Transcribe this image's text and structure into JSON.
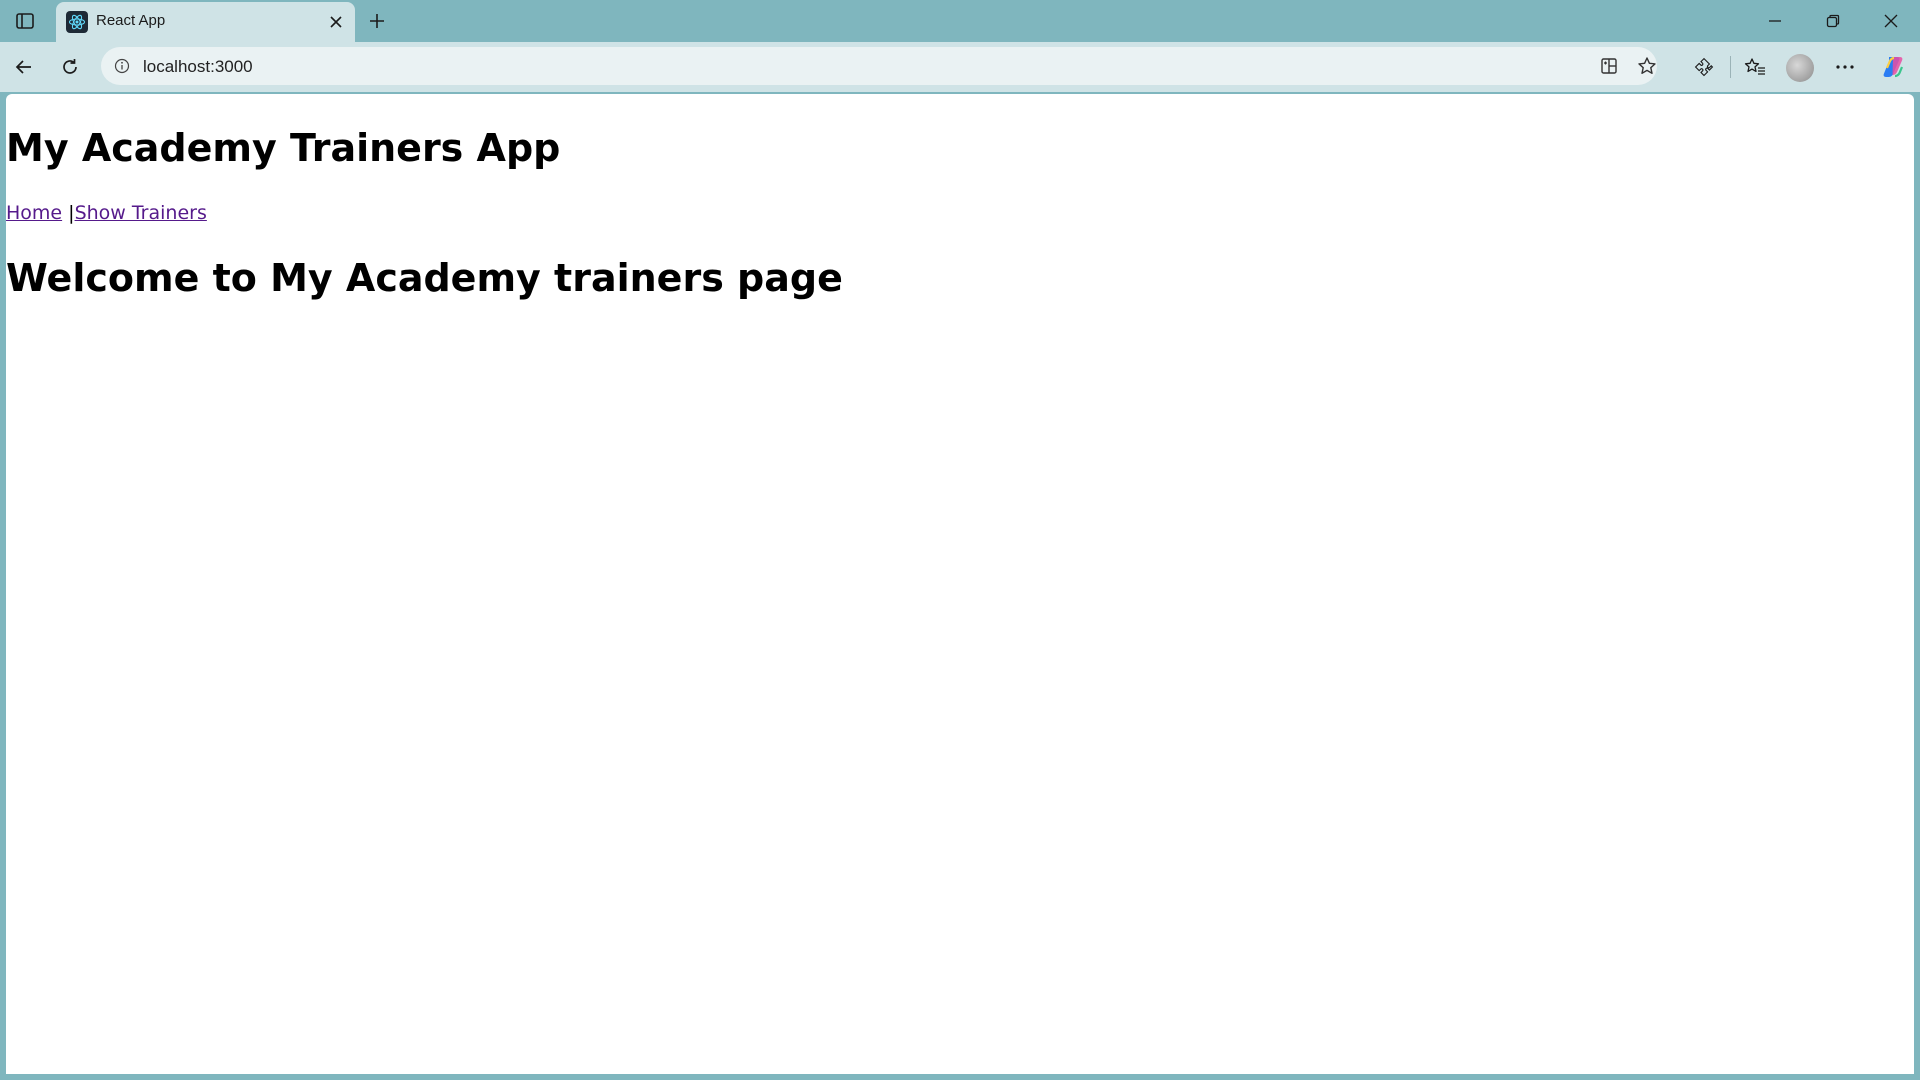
{
  "browser": {
    "tab": {
      "title": "React App",
      "favicon": "react-logo-icon"
    },
    "address": {
      "url": "localhost:3000"
    },
    "icons": {
      "sidebar": "sidebar-icon",
      "close_tab": "close-icon",
      "new_tab": "plus-icon",
      "back": "back-arrow-icon",
      "reload": "reload-icon",
      "site_info": "info-icon",
      "app_available": "app-available-icon",
      "favorite": "star-icon",
      "extensions": "puzzle-icon",
      "favorites": "favorites-icon",
      "profile": "avatar",
      "more": "more-icon",
      "copilot": "copilot-icon"
    }
  },
  "page": {
    "title": "My Academy Trainers App",
    "nav": {
      "home": "Home",
      "separator": "|",
      "show_trainers": "Show Trainers"
    },
    "welcome": "Welcome to My Academy trainers page"
  },
  "colors": {
    "frame": "#7fb6be",
    "toolbar": "#cfe3e6",
    "link_visited": "#551a8b"
  }
}
